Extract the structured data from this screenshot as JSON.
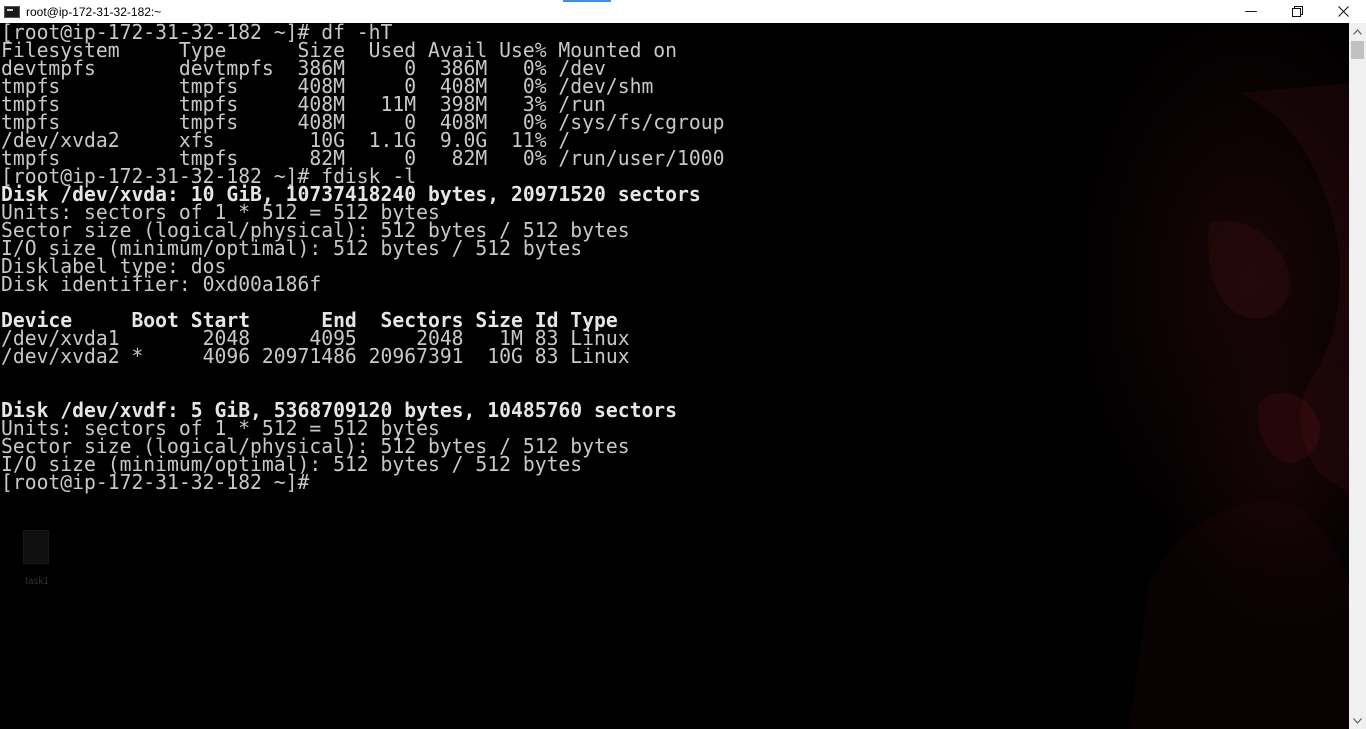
{
  "window": {
    "title": "root@ip-172-31-32-182:~",
    "controls": {
      "minimize": "—",
      "maximize": "maximize",
      "close": "close"
    }
  },
  "terminal": {
    "lines": [
      "[root@ip-172-31-32-182 ~]# df -hT",
      "Filesystem     Type      Size  Used Avail Use% Mounted on",
      "devtmpfs       devtmpfs  386M     0  386M   0% /dev",
      "tmpfs          tmpfs     408M     0  408M   0% /dev/shm",
      "tmpfs          tmpfs     408M   11M  398M   3% /run",
      "tmpfs          tmpfs     408M     0  408M   0% /sys/fs/cgroup",
      "/dev/xvda2     xfs        10G  1.1G  9.0G  11% /",
      "tmpfs          tmpfs      82M     0   82M   0% /run/user/1000",
      "[root@ip-172-31-32-182 ~]# fdisk -l",
      "Disk /dev/xvda: 10 GiB, 10737418240 bytes, 20971520 sectors",
      "Units: sectors of 1 * 512 = 512 bytes",
      "Sector size (logical/physical): 512 bytes / 512 bytes",
      "I/O size (minimum/optimal): 512 bytes / 512 bytes",
      "Disklabel type: dos",
      "Disk identifier: 0xd00a186f",
      "",
      "Device     Boot Start      End  Sectors Size Id Type",
      "/dev/xvda1       2048     4095     2048   1M 83 Linux",
      "/dev/xvda2 *     4096 20971486 20967391  10G 83 Linux",
      "",
      "",
      "Disk /dev/xvdf: 5 GiB, 5368709120 bytes, 10485760 sectors",
      "Units: sectors of 1 * 512 = 512 bytes",
      "Sector size (logical/physical): 512 bytes / 512 bytes",
      "I/O size (minimum/optimal): 512 bytes / 512 bytes",
      "[root@ip-172-31-32-182 ~]#"
    ],
    "bold_lines": [
      9,
      16,
      21
    ],
    "foreground_color": "#c8c8c8",
    "background_color": "#000000"
  },
  "desktop_icon": {
    "label": "task1",
    "icon": "document-icon"
  },
  "colors": {
    "titlebar_bg": "#ffffff",
    "scrollbar_bg": "#f0f0f0",
    "scrollbar_thumb": "#c1c1c1",
    "accent": "#3d8ee0"
  }
}
